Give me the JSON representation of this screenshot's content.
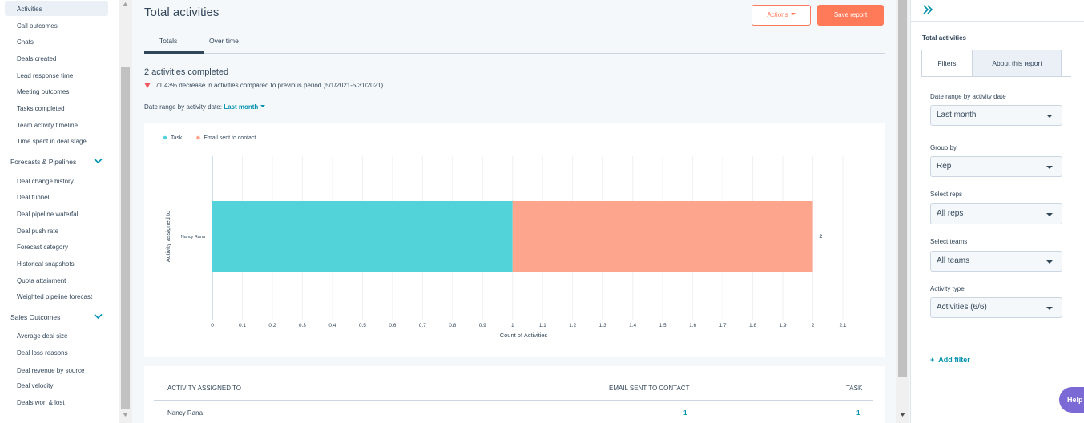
{
  "sidebar": {
    "items_group1": [
      "Activities",
      "Call outcomes",
      "Chats",
      "Deals created",
      "Lead response time",
      "Meeting outcomes",
      "Tasks completed",
      "Team activity timeline",
      "Time spent in deal stage"
    ],
    "section2": "Forecasts & Pipelines",
    "items_group2": [
      "Deal change history",
      "Deal funnel",
      "Deal pipeline waterfall",
      "Deal push rate",
      "Forecast category",
      "Historical snapshots",
      "Quota attainment",
      "Weighted pipeline forecast"
    ],
    "section3": "Sales Outcomes",
    "items_group3": [
      "Average deal size",
      "Deal loss reasons",
      "Deal revenue by source",
      "Deal velocity",
      "Deals won & lost"
    ]
  },
  "header": {
    "title": "Total activities",
    "actions_label": "Actions",
    "save_label": "Save report"
  },
  "tabs": [
    "Totals",
    "Over time"
  ],
  "summary": {
    "count_text": "2 activities completed",
    "change_text": "71.43% decrease in activities compared to previous period (5/1/2021-5/31/2021)",
    "date_range_label": "Date range by activity date:",
    "date_range_value": "Last month"
  },
  "chart_data": {
    "type": "bar",
    "orientation": "horizontal",
    "stacked": true,
    "categories": [
      "Nancy Rana"
    ],
    "series": [
      {
        "name": "Task",
        "values": [
          1
        ],
        "color": "#51d3d9"
      },
      {
        "name": "Email sent to contact",
        "values": [
          1
        ],
        "color": "#fea58e"
      }
    ],
    "totals": [
      "2"
    ],
    "xlabel": "Count of Activities",
    "ylabel": "Activity assigned to",
    "xlim": [
      0,
      2.1
    ],
    "xticks": [
      "0",
      "0.1",
      "0.2",
      "0.3",
      "0.4",
      "0.5",
      "0.6",
      "0.7",
      "0.8",
      "0.9",
      "1",
      "1.1",
      "1.2",
      "1.3",
      "1.4",
      "1.5",
      "1.6",
      "1.7",
      "1.8",
      "1.9",
      "2",
      "2.1"
    ],
    "legend_position": "top-left",
    "grid": true
  },
  "table": {
    "headers": [
      "Activity assigned to",
      "Email sent to contact",
      "Task"
    ],
    "rows": [
      [
        "Nancy Rana",
        "1",
        "1"
      ]
    ]
  },
  "panel": {
    "title": "Total activities",
    "tabs": [
      "Filters",
      "About this report"
    ],
    "filters": [
      {
        "label": "Date range by activity date",
        "value": "Last month"
      },
      {
        "label": "Group by",
        "value": "Rep"
      },
      {
        "label": "Select reps",
        "value": "All reps"
      },
      {
        "label": "Select teams",
        "value": "All teams"
      },
      {
        "label": "Activity type",
        "value": "Activities (6/6)"
      }
    ],
    "add_filter": "Add filter",
    "help": "Help"
  }
}
